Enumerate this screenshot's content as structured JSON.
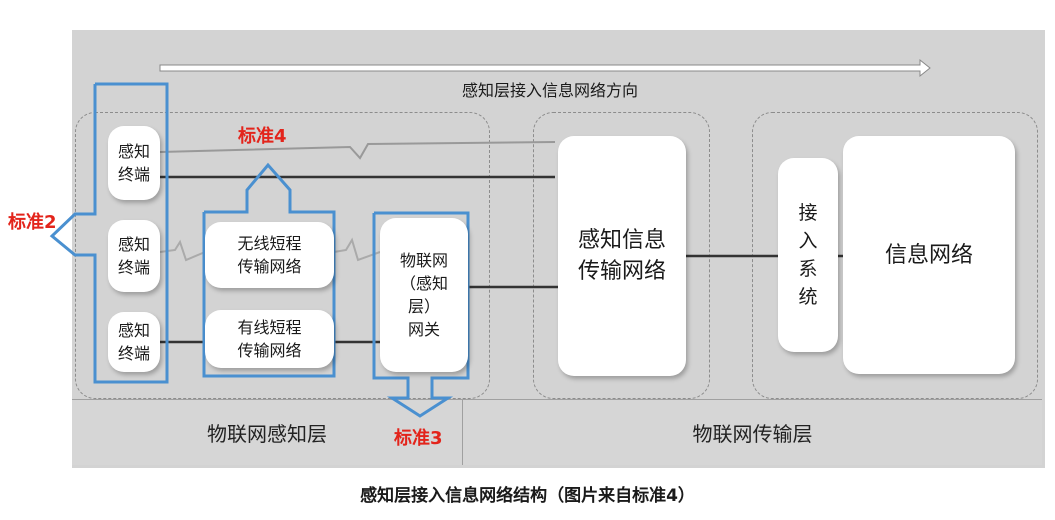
{
  "direction_label": "感知层接入信息网络方向",
  "nodes": {
    "terminal_1": "感知\n终端",
    "terminal_2": "感知\n终端",
    "terminal_3": "感知\n终端",
    "wireless_short": "无线短程\n传输网络",
    "wired_short": "有线短程\n传输网络",
    "gateway": "物联网\n（感知\n层）\n网关",
    "sensing_transport": "感知信息\n传输网络",
    "access_system": "接\n入\n系\n统",
    "info_network": "信息网络"
  },
  "layers": {
    "sensing": "物联网感知层",
    "transport": "物联网传输层"
  },
  "standards": {
    "s2": "标准2",
    "s3": "标准3",
    "s4": "标准4"
  },
  "caption": "感知层接入信息网络结构（图片来自标准4）",
  "colors": {
    "standard_outline": "#4a90d0",
    "standard_label": "#e3241b"
  }
}
